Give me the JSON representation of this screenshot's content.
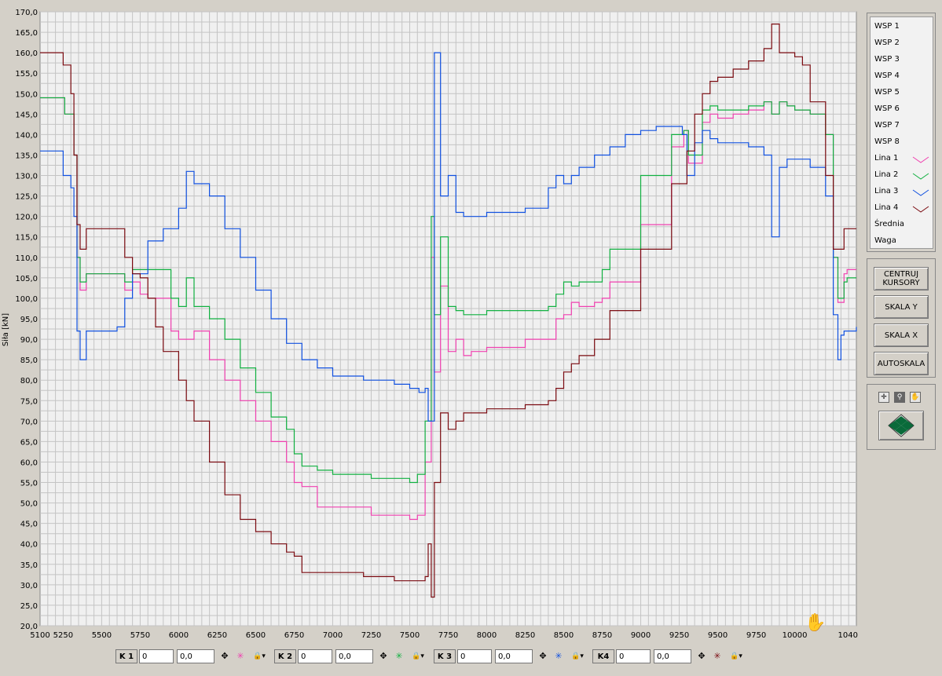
{
  "chart_data": {
    "type": "line",
    "ylabel": "Siła [kN]",
    "xlim": [
      5100,
      10400
    ],
    "ylim": [
      20,
      170
    ],
    "x_ticks": [
      "5100",
      "5250",
      "5500",
      "5750",
      "6000",
      "6250",
      "6500",
      "6750",
      "7000",
      "7250",
      "7500",
      "7750",
      "8000",
      "8250",
      "8500",
      "8750",
      "9000",
      "9250",
      "9500",
      "9750",
      "10000",
      "1040"
    ],
    "y_ticks": [
      "20,0",
      "25,0",
      "30,0",
      "35,0",
      "40,0",
      "45,0",
      "50,0",
      "55,0",
      "60,0",
      "65,0",
      "70,0",
      "75,0",
      "80,0",
      "85,0",
      "90,0",
      "95,0",
      "100,0",
      "105,0",
      "110,0",
      "115,0",
      "120,0",
      "125,0",
      "130,0",
      "135,0",
      "140,0",
      "145,0",
      "150,0",
      "155,0",
      "160,0",
      "165,0",
      "170,0"
    ],
    "grid": true,
    "series": [
      {
        "name": "Lina 1",
        "color": "#f040b0",
        "x": [
          5100,
          5200,
          5260,
          5300,
          5320,
          5340,
          5360,
          5400,
          5500,
          5600,
          5650,
          5700,
          5750,
          5800,
          5900,
          5950,
          6000,
          6100,
          6200,
          6300,
          6400,
          6500,
          6600,
          6700,
          6750,
          6800,
          6900,
          7000,
          7250,
          7500,
          7550,
          7600,
          7640,
          7660,
          7700,
          7750,
          7800,
          7850,
          7900,
          8000,
          8250,
          8400,
          8450,
          8500,
          8550,
          8600,
          8700,
          8750,
          8800,
          9000,
          9200,
          9280,
          9310,
          9400,
          9450,
          9500,
          9600,
          9700,
          9800,
          9850,
          9900,
          9950,
          10000,
          10100,
          10200,
          10250,
          10280,
          10320,
          10340,
          10400
        ],
        "y": [
          149,
          149,
          145,
          145,
          135,
          110,
          102,
          106,
          106,
          106,
          102,
          104,
          101,
          100,
          100,
          92,
          90,
          92,
          85,
          80,
          75,
          70,
          65,
          60,
          55,
          54,
          49,
          49,
          47,
          46,
          47,
          60,
          110,
          82,
          103,
          87,
          90,
          86,
          87,
          88,
          90,
          90,
          95,
          96,
          99,
          98,
          99,
          100,
          104,
          118,
          137,
          141,
          133,
          143,
          145,
          144,
          145,
          146,
          148,
          145,
          148,
          147,
          146,
          145,
          140,
          110,
          99,
          106,
          107,
          107
        ]
      },
      {
        "name": "Lina 2",
        "color": "#10b040",
        "x": [
          5100,
          5200,
          5260,
          5300,
          5320,
          5340,
          5360,
          5400,
          5500,
          5600,
          5650,
          5700,
          5750,
          5800,
          5900,
          5950,
          6000,
          6050,
          6100,
          6200,
          6300,
          6400,
          6500,
          6600,
          6700,
          6750,
          6800,
          6900,
          7000,
          7250,
          7500,
          7550,
          7600,
          7640,
          7660,
          7700,
          7750,
          7800,
          7850,
          7900,
          8000,
          8250,
          8400,
          8450,
          8500,
          8550,
          8600,
          8700,
          8750,
          8800,
          9000,
          9200,
          9280,
          9310,
          9400,
          9450,
          9500,
          9600,
          9700,
          9800,
          9850,
          9900,
          9950,
          10000,
          10100,
          10200,
          10250,
          10280,
          10320,
          10340,
          10400
        ],
        "y": [
          149,
          149,
          145,
          145,
          135,
          110,
          104,
          106,
          106,
          106,
          104,
          107,
          107,
          107,
          107,
          100,
          98,
          105,
          98,
          95,
          90,
          83,
          77,
          71,
          68,
          62,
          59,
          58,
          57,
          56,
          55,
          57,
          70,
          120,
          96,
          115,
          98,
          97,
          96,
          96,
          97,
          97,
          98,
          101,
          104,
          103,
          104,
          104,
          107,
          112,
          130,
          140,
          141,
          135,
          146,
          147,
          146,
          146,
          147,
          148,
          145,
          148,
          147,
          146,
          145,
          140,
          110,
          100,
          104,
          105,
          105
        ]
      },
      {
        "name": "Lina 3",
        "color": "#1050e0",
        "x": [
          5100,
          5200,
          5250,
          5300,
          5320,
          5340,
          5360,
          5400,
          5450,
          5500,
          5550,
          5600,
          5650,
          5700,
          5800,
          5900,
          6000,
          6050,
          6100,
          6200,
          6300,
          6400,
          6500,
          6600,
          6700,
          6800,
          6900,
          7000,
          7200,
          7400,
          7500,
          7560,
          7600,
          7620,
          7660,
          7700,
          7750,
          7800,
          7850,
          7900,
          8000,
          8100,
          8250,
          8400,
          8450,
          8500,
          8550,
          8600,
          8700,
          8800,
          8900,
          9000,
          9100,
          9200,
          9270,
          9300,
          9350,
          9400,
          9450,
          9500,
          9600,
          9700,
          9800,
          9850,
          9900,
          9950,
          10000,
          10100,
          10200,
          10250,
          10280,
          10300,
          10320,
          10350,
          10400
        ],
        "y": [
          136,
          136,
          130,
          127,
          120,
          92,
          85,
          92,
          92,
          92,
          92,
          93,
          100,
          106,
          114,
          117,
          122,
          131,
          128,
          125,
          117,
          110,
          102,
          95,
          89,
          85,
          83,
          81,
          80,
          79,
          78,
          77,
          78,
          70,
          160,
          125,
          130,
          121,
          120,
          120,
          121,
          121,
          122,
          127,
          130,
          128,
          130,
          132,
          135,
          137,
          140,
          141,
          142,
          142,
          140,
          130,
          138,
          141,
          139,
          138,
          138,
          137,
          135,
          115,
          132,
          134,
          134,
          132,
          125,
          96,
          85,
          91,
          92,
          92,
          93
        ]
      },
      {
        "name": "Lina 4",
        "color": "#7a0a10",
        "x": [
          5100,
          5200,
          5250,
          5300,
          5320,
          5340,
          5360,
          5400,
          5500,
          5600,
          5650,
          5700,
          5750,
          5800,
          5850,
          5900,
          6000,
          6050,
          6100,
          6200,
          6300,
          6400,
          6500,
          6600,
          6700,
          6750,
          6800,
          6900,
          7000,
          7200,
          7400,
          7500,
          7550,
          7600,
          7620,
          7640,
          7660,
          7700,
          7750,
          7800,
          7850,
          7900,
          8000,
          8250,
          8400,
          8450,
          8500,
          8550,
          8600,
          8700,
          8800,
          9000,
          9200,
          9300,
          9350,
          9400,
          9450,
          9500,
          9600,
          9700,
          9800,
          9850,
          9900,
          9950,
          10000,
          10050,
          10100,
          10200,
          10250,
          10280,
          10320,
          10340,
          10400
        ],
        "y": [
          160,
          160,
          157,
          150,
          135,
          118,
          112,
          117,
          117,
          117,
          110,
          106,
          105,
          100,
          93,
          87,
          80,
          75,
          70,
          60,
          52,
          46,
          43,
          40,
          38,
          37,
          33,
          33,
          33,
          32,
          31,
          31,
          31,
          32,
          40,
          27,
          55,
          72,
          68,
          70,
          72,
          72,
          73,
          74,
          75,
          78,
          82,
          84,
          86,
          90,
          97,
          112,
          128,
          136,
          145,
          150,
          153,
          154,
          156,
          158,
          161,
          167,
          160,
          160,
          159,
          157,
          148,
          130,
          112,
          112,
          117,
          117,
          117
        ]
      }
    ]
  },
  "legend": {
    "items": [
      "WSP 1",
      "WSP 2",
      "WSP 3",
      "WSP 4",
      "WSP 5",
      "WSP 6",
      "WSP 7",
      "WSP 8",
      "Lina 1",
      "Lina 2",
      "Lina 3",
      "Lina 4",
      "Średnia",
      "Waga"
    ],
    "swatch_colors": [
      "",
      "",
      "",
      "",
      "",
      "",
      "",
      "",
      "#f040b0",
      "#10b040",
      "#1050e0",
      "#7a0a10",
      "",
      ""
    ]
  },
  "buttons": {
    "centruj": "CENTRUJ KURSORY",
    "skala_y": "SKALA Y",
    "skala_x": "SKALA X",
    "autoskala": "AUTOSKALA"
  },
  "cursors": [
    {
      "label": "K 1",
      "x_value": "0",
      "y_value": "0,0",
      "color": "#f040b0"
    },
    {
      "label": "K 2",
      "x_value": "0",
      "y_value": "0,0",
      "color": "#10b040"
    },
    {
      "label": "K 3",
      "x_value": "0",
      "y_value": "0,0",
      "color": "#1050e0"
    },
    {
      "label": "K4",
      "x_value": "0",
      "y_value": "0,0",
      "color": "#7a0a10"
    }
  ],
  "icons": {
    "move_icon": "move-cursor-icon",
    "cross_icon": "crosshair-icon",
    "lock_icon": "lock-icon",
    "zoom_icon": "zoom-icon",
    "pan_icon": "hand-pan-icon",
    "nav_icon": "navigation-diamond-icon"
  }
}
